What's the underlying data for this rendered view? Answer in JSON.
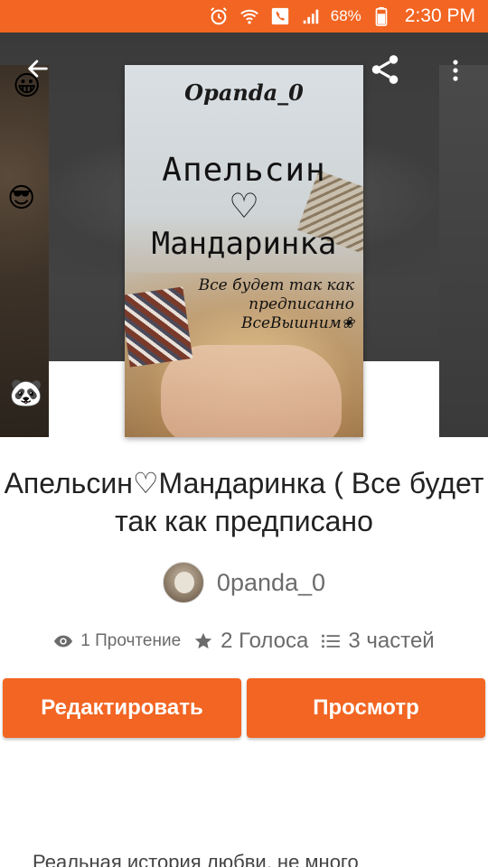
{
  "status_bar": {
    "battery_text": "68%",
    "time": "2:30 PM"
  },
  "header": {
    "back_icon": "arrow-left-icon",
    "share_icon": "share-icon",
    "more_icon": "more-vertical-icon"
  },
  "cover": {
    "author_text": "Opanda_0",
    "title_line1": "Апельсин",
    "heart": "♡",
    "title_line2": "Мандаринка",
    "subtitle": "Все будет так как предписанно ВсеВышним❀"
  },
  "book": {
    "title": "Апельсин♡Мандаринка ( Все будет так как предписано",
    "author": "0panda_0"
  },
  "stats": {
    "reads": "1 Прочтение",
    "votes": "2 Голоса",
    "parts": "3 частей"
  },
  "actions": {
    "edit_label": "Редактировать",
    "view_label": "Просмотр"
  },
  "description": "Реальная история любви, не много",
  "colors": {
    "accent": "#f26522",
    "text_primary": "#222222",
    "text_secondary": "#6b6b6b"
  }
}
